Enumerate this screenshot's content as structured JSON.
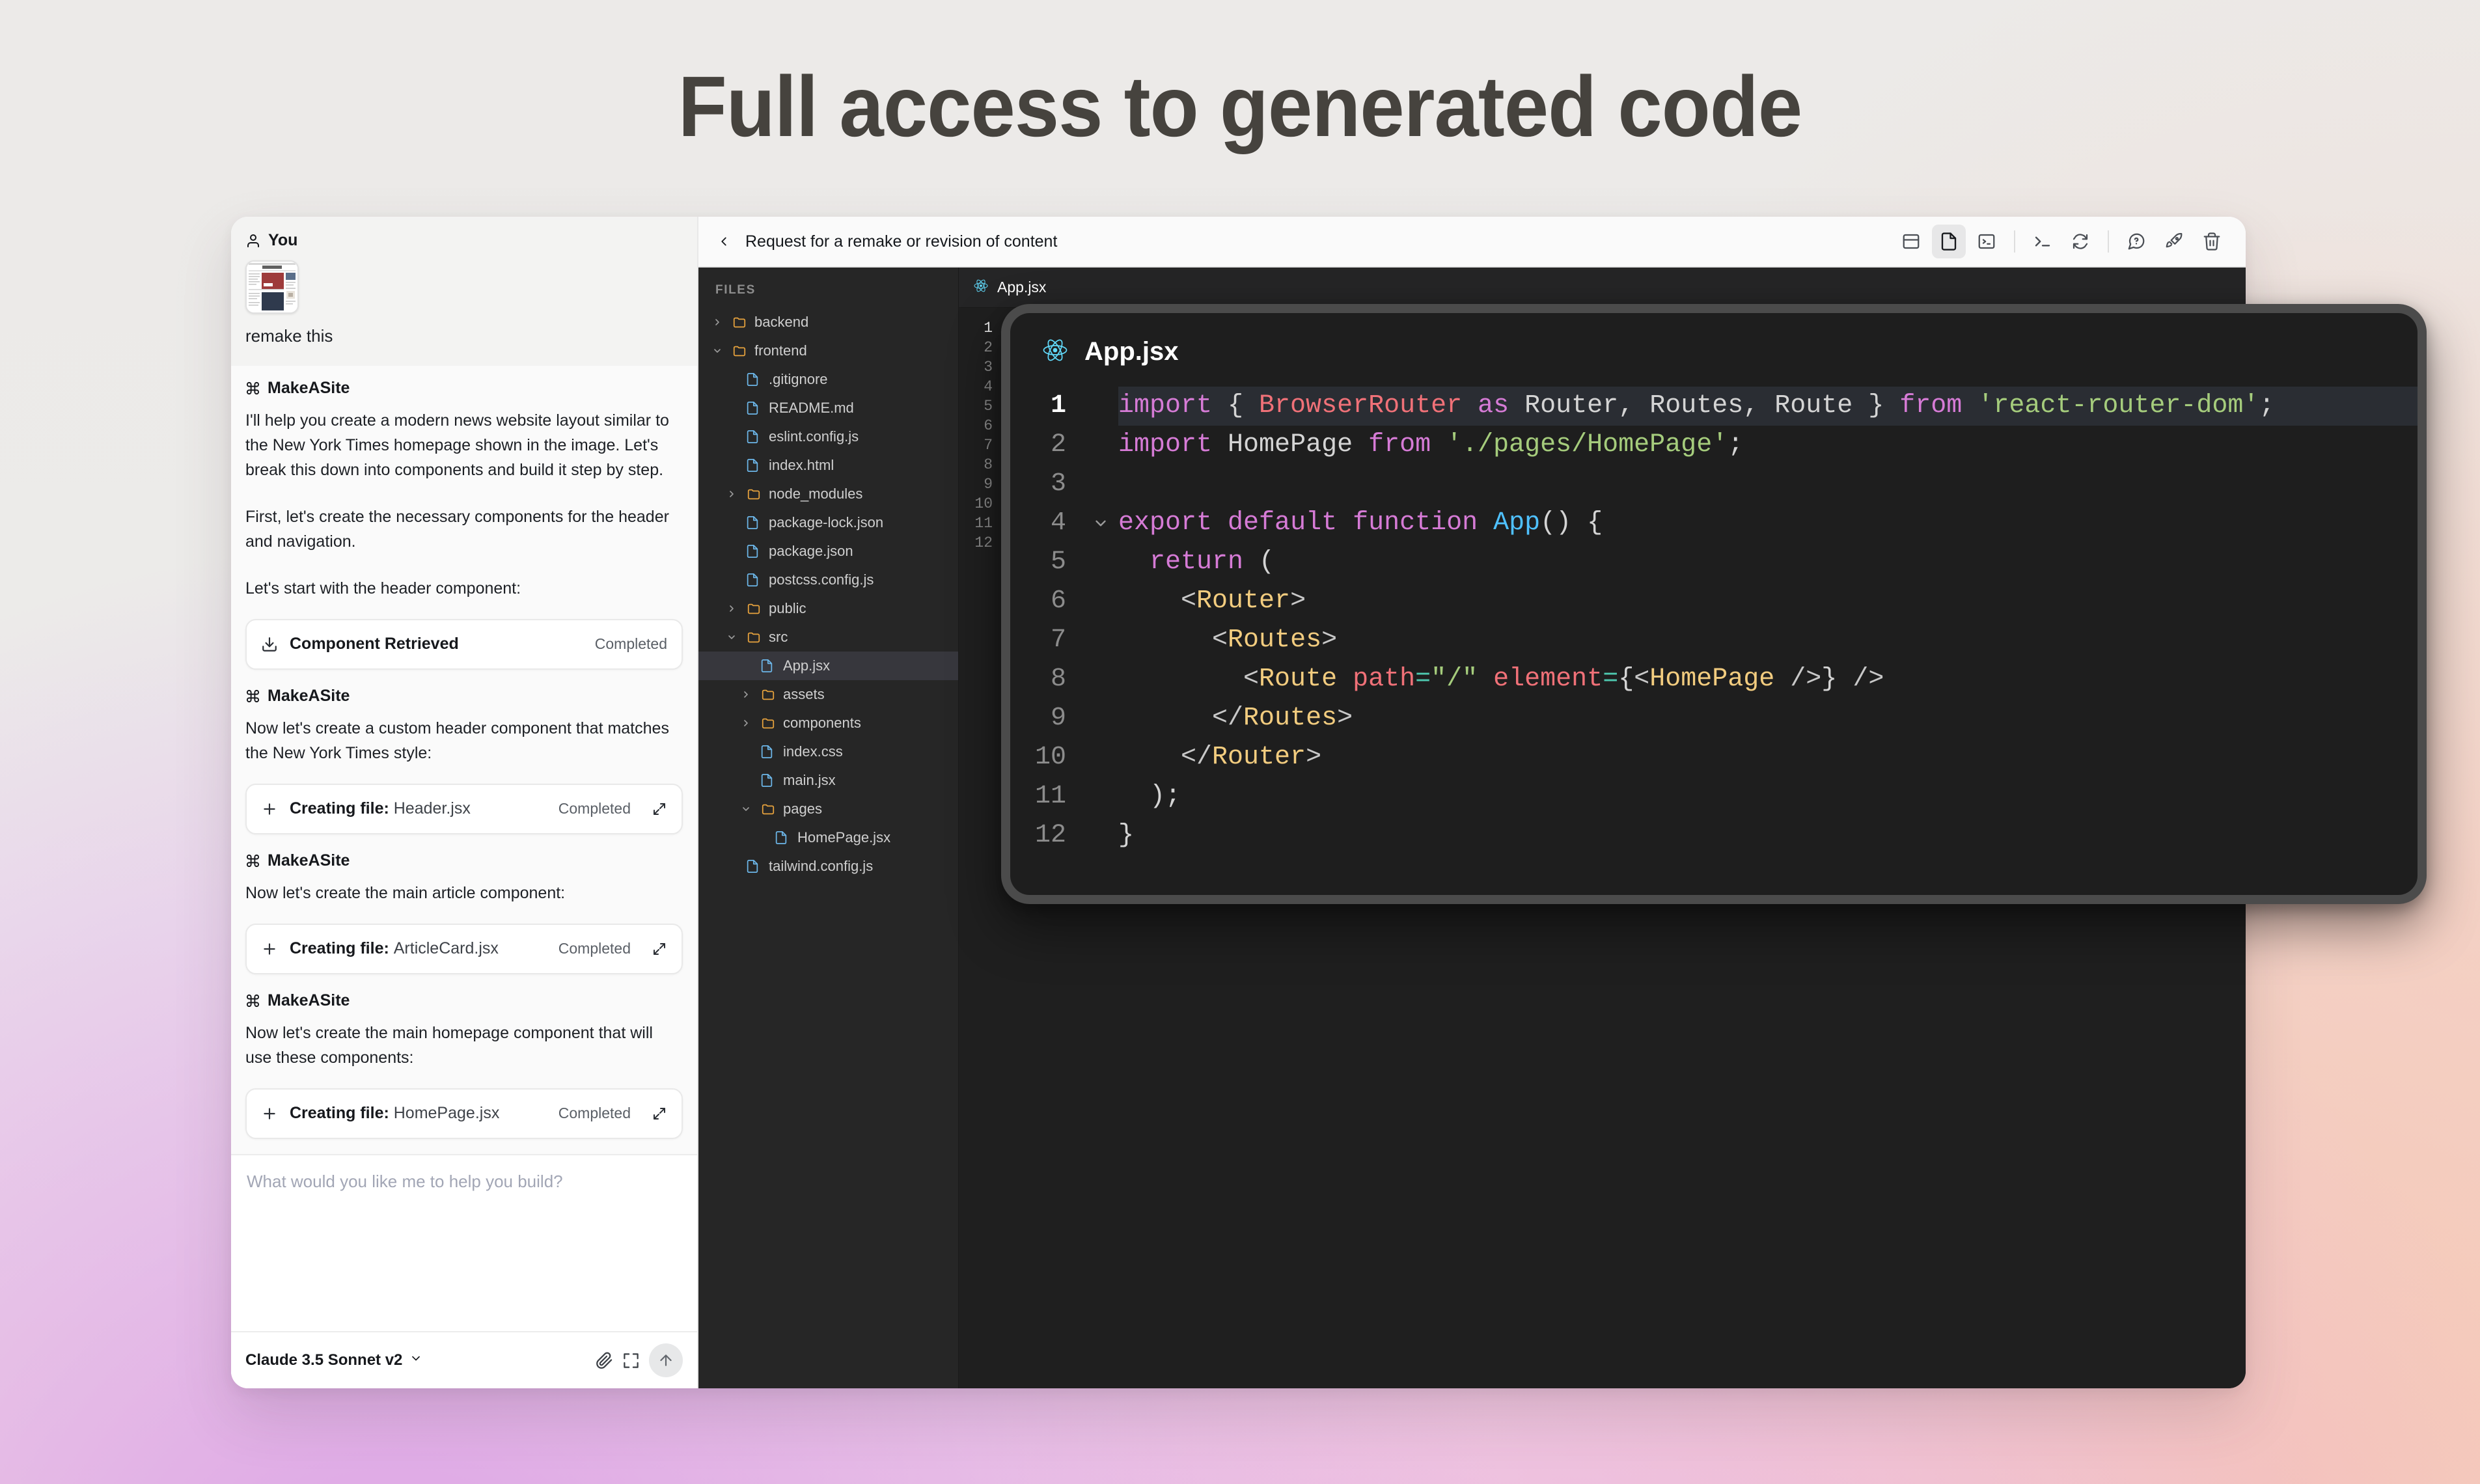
{
  "hero": {
    "title": "Full access to generated code"
  },
  "chat": {
    "user": {
      "author": "You",
      "author_icon": "person-icon",
      "attachment_alt": "The New York Times homepage screenshot",
      "text": "remake this"
    },
    "assistant_name": "MakeASite",
    "messages": [
      {
        "author": "MakeASite",
        "paragraphs": [
          "I'll help you create a modern news website layout similar to the New York Times homepage shown in the image. Let's break this down into components and build it step by step.",
          "First, let's create the necessary components for the header and navigation.",
          "Let's start with the header component:"
        ]
      },
      {
        "author": "MakeASite",
        "paragraphs": [
          "Now let's create a custom header component that matches the New York Times style:"
        ]
      },
      {
        "author": "MakeASite",
        "paragraphs": [
          "Now let's create the main article component:"
        ]
      },
      {
        "author": "MakeASite",
        "paragraphs": [
          "Now let's create the main homepage component that will use these components:"
        ]
      }
    ],
    "cards": [
      {
        "icon": "download-icon",
        "label": "Component Retrieved",
        "filename": "",
        "status": "Completed",
        "expandable": false
      },
      {
        "icon": "plus-icon",
        "label": "Creating file:",
        "filename": "Header.jsx",
        "status": "Completed",
        "expandable": true
      },
      {
        "icon": "plus-icon",
        "label": "Creating file:",
        "filename": "ArticleCard.jsx",
        "status": "Completed",
        "expandable": true
      },
      {
        "icon": "plus-icon",
        "label": "Creating file:",
        "filename": "HomePage.jsx",
        "status": "Completed",
        "expandable": true
      }
    ],
    "composer": {
      "placeholder": "What would you like me to help you build?",
      "model": "Claude 3.5 Sonnet v2",
      "attach_icon": "paperclip-icon",
      "expand_icon": "expand-icon",
      "send_icon": "arrow-up-icon"
    }
  },
  "ide": {
    "topbar": {
      "back_icon": "chevron-left-icon",
      "title": "Request for a remake or revision of content",
      "icons": [
        {
          "name": "layout-panel-icon",
          "active": false
        },
        {
          "name": "file-icon",
          "active": true
        },
        {
          "name": "terminal-box-icon",
          "active": false
        },
        {
          "name": "console-prompt-icon",
          "active": false
        },
        {
          "name": "refresh-icon",
          "active": false
        },
        {
          "name": "help-circle-icon",
          "active": false
        },
        {
          "name": "rocket-icon",
          "active": false
        },
        {
          "name": "trash-icon",
          "active": false
        }
      ]
    },
    "files_header": "FILES",
    "tree": [
      {
        "label": "backend",
        "type": "folder",
        "depth": 0,
        "chevron": "right",
        "selected": false
      },
      {
        "label": "frontend",
        "type": "folder",
        "depth": 0,
        "chevron": "down",
        "selected": false
      },
      {
        "label": ".gitignore",
        "type": "file",
        "depth": 1,
        "chevron": "none",
        "selected": false
      },
      {
        "label": "README.md",
        "type": "file",
        "depth": 1,
        "chevron": "none",
        "selected": false
      },
      {
        "label": "eslint.config.js",
        "type": "file",
        "depth": 1,
        "chevron": "none",
        "selected": false
      },
      {
        "label": "index.html",
        "type": "file",
        "depth": 1,
        "chevron": "none",
        "selected": false
      },
      {
        "label": "node_modules",
        "type": "folder",
        "depth": 1,
        "chevron": "right",
        "selected": false
      },
      {
        "label": "package-lock.json",
        "type": "file",
        "depth": 1,
        "chevron": "none",
        "selected": false
      },
      {
        "label": "package.json",
        "type": "file",
        "depth": 1,
        "chevron": "none",
        "selected": false
      },
      {
        "label": "postcss.config.js",
        "type": "file",
        "depth": 1,
        "chevron": "none",
        "selected": false
      },
      {
        "label": "public",
        "type": "folder",
        "depth": 1,
        "chevron": "right",
        "selected": false
      },
      {
        "label": "src",
        "type": "folder",
        "depth": 1,
        "chevron": "down",
        "selected": false
      },
      {
        "label": "App.jsx",
        "type": "file",
        "depth": 2,
        "chevron": "none",
        "selected": true
      },
      {
        "label": "assets",
        "type": "folder",
        "depth": 2,
        "chevron": "right",
        "selected": false
      },
      {
        "label": "components",
        "type": "folder",
        "depth": 2,
        "chevron": "right",
        "selected": false
      },
      {
        "label": "index.css",
        "type": "file",
        "depth": 2,
        "chevron": "none",
        "selected": false
      },
      {
        "label": "main.jsx",
        "type": "file",
        "depth": 2,
        "chevron": "none",
        "selected": false
      },
      {
        "label": "pages",
        "type": "folder",
        "depth": 2,
        "chevron": "down",
        "selected": false
      },
      {
        "label": "HomePage.jsx",
        "type": "file",
        "depth": 3,
        "chevron": "none",
        "selected": false
      },
      {
        "label": "tailwind.config.js",
        "type": "file",
        "depth": 1,
        "chevron": "none",
        "selected": false
      }
    ],
    "editor_tab": {
      "label": "App.jsx",
      "icon": "react-icon"
    },
    "background_line_numbers": [
      "1",
      "2",
      "3",
      "4",
      "5",
      "6",
      "7",
      "8",
      "9",
      "10",
      "11",
      "12"
    ]
  },
  "overlay": {
    "title": "App.jsx",
    "icon": "react-icon",
    "line_numbers": [
      "1",
      "2",
      "3",
      "4",
      "5",
      "6",
      "7",
      "8",
      "9",
      "10",
      "11",
      "12"
    ],
    "current_line": 1,
    "fold_markers": {
      "4": "chevron-down-icon"
    },
    "code_lines": [
      "import { BrowserRouter as Router, Routes, Route } from 'react-router-dom';",
      "import HomePage from './pages/HomePage';",
      "",
      "export default function App() {",
      "  return (",
      "    <Router>",
      "      <Routes>",
      "        <Route path=\"/\" element={<HomePage />} />",
      "      </Routes>",
      "    </Router>",
      "  );",
      "}"
    ]
  },
  "colors": {
    "accent_react": "#61dafb",
    "folder": "#e8a33d",
    "file": "#6cb6e8",
    "keyword": "#d67bd6",
    "class": "#f07178",
    "string": "#a5cc7c",
    "tag": "#f2cc7f",
    "function": "#4fc1ff"
  }
}
